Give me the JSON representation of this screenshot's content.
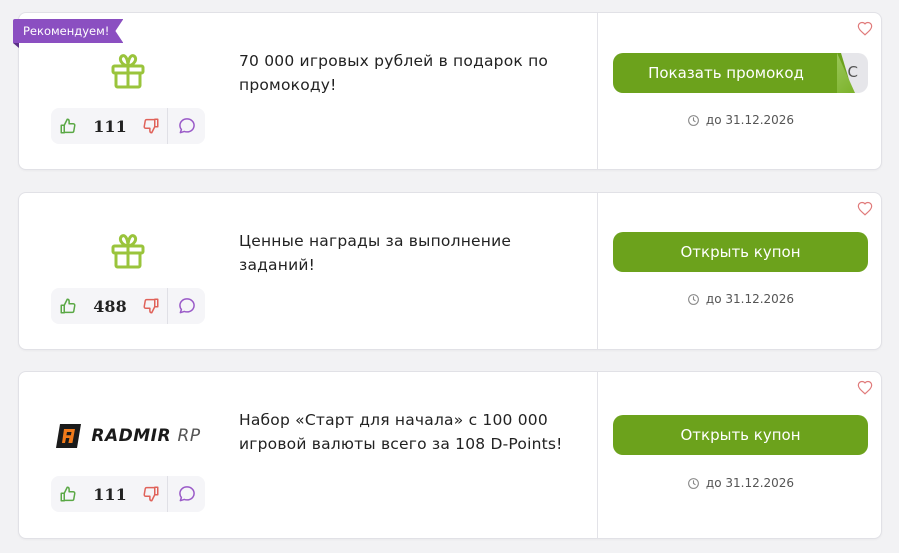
{
  "colors": {
    "accent": "#6ca21c",
    "badge": "#8b4fc1",
    "heart": "#e06c6c"
  },
  "coupons": [
    {
      "badge": "Рекомендуем!",
      "logo": "gift-icon",
      "likes": "111",
      "description": "70 000 игровых рублей в подарок по промокоду!",
      "button_label": "Показать промокод",
      "code_peek": "C",
      "date": "до 31.12.2026"
    },
    {
      "logo": "gift-icon",
      "likes": "488",
      "description": "Ценные награды за выполнение заданий!",
      "button_label": "Открыть купон",
      "date": "до 31.12.2026"
    },
    {
      "logo": "radmir-logo",
      "logo_text": "RADMIR",
      "logo_suffix": "RP",
      "likes": "111",
      "description": "Набор «Старт для начала» с 100 000 игровой валюты всего за 108 D-Points!",
      "button_label": "Открыть купон",
      "date": "до 31.12.2026"
    }
  ]
}
